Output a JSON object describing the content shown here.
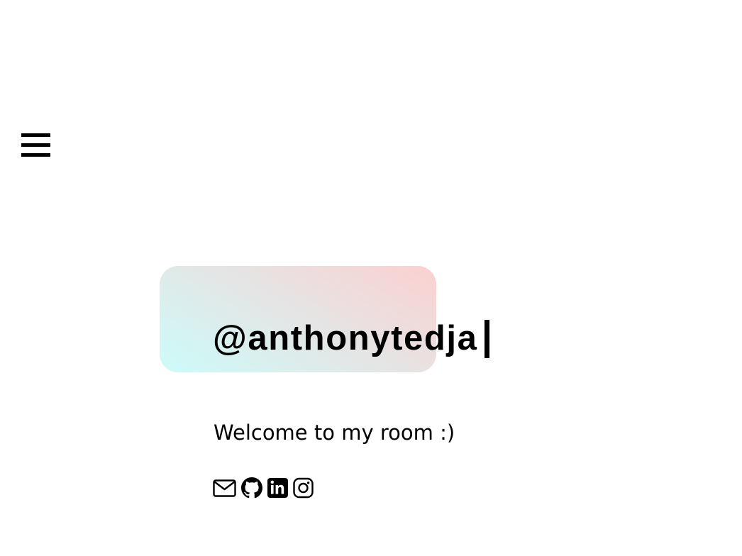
{
  "header": {
    "menu_icon": "hamburger-menu-icon"
  },
  "hero": {
    "handle": "@anthonytedja",
    "welcome": "Welcome to my room :)",
    "card_gradient": {
      "start": "#ccfbfa",
      "end": "#fcd0d0"
    }
  },
  "socials": [
    {
      "icon": "envelope-icon"
    },
    {
      "icon": "github-icon"
    },
    {
      "icon": "linkedin-icon"
    },
    {
      "icon": "instagram-icon"
    }
  ],
  "colors": {
    "text": "#000000",
    "background": "#ffffff"
  }
}
